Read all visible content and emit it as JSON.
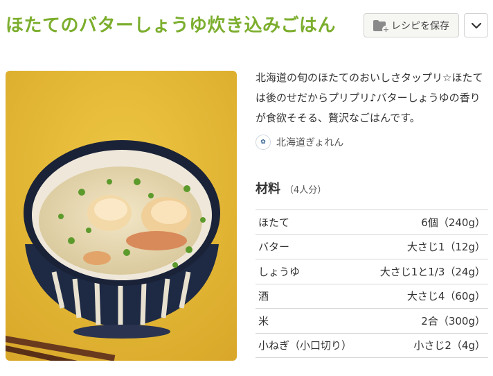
{
  "recipe": {
    "title": "ほたてのバターしょうゆ炊き込みごはん",
    "description": "北海道の旬のほたてのおいしさタップリ☆ほたては後のせだからプリプリ♪バターしょうゆの香りが食欲そそる、贅沢なごはんです。",
    "author": "北海道ぎょれん"
  },
  "actions": {
    "save_label": "レシピを保存",
    "save_icon": "folder-plus-icon",
    "more_icon": "chevron-down-icon"
  },
  "ingredients": {
    "title": "材料",
    "servings": "（4人分）",
    "items": [
      {
        "name": "ほたて",
        "amount": "6個（240g）"
      },
      {
        "name": "バター",
        "amount": "大さじ1（12g）"
      },
      {
        "name": "しょうゆ",
        "amount": "大さじ1と1/3（24g）"
      },
      {
        "name": "酒",
        "amount": "大さじ4（60g）"
      },
      {
        "name": "米",
        "amount": "2合（300g）"
      },
      {
        "name": "小ねぎ（小口切り）",
        "amount": "小さじ2（4g）"
      }
    ]
  },
  "colors": {
    "title": "#7cae2e",
    "background_photo": "#e2b52c"
  }
}
